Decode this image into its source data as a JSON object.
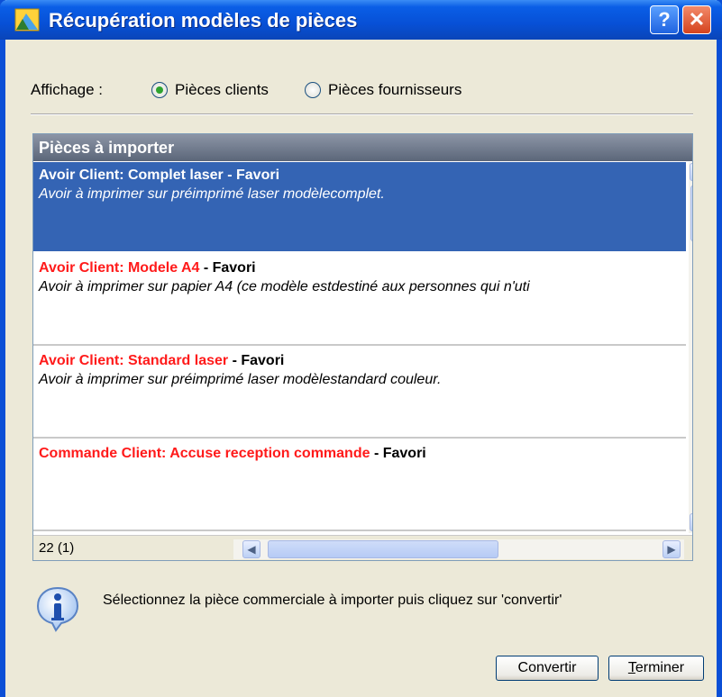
{
  "window": {
    "title": "Récupération modèles de pièces",
    "help_label": "?",
    "close_label": "✕",
    "colors": {
      "titlebar": "#0750d6",
      "selection": "#3464b4",
      "item_name": "#ff1a1a"
    }
  },
  "filter": {
    "label": "Affichage :",
    "options": [
      {
        "label": "Pièces clients",
        "selected": true
      },
      {
        "label": "Pièces fournisseurs",
        "selected": false
      }
    ]
  },
  "list": {
    "header": "Pièces à importer",
    "items": [
      {
        "name": "Avoir Client: Complet laser",
        "suffix": " - Favori",
        "description": "Avoir à imprimer sur préimprimé laser modèlecomplet.",
        "selected": true
      },
      {
        "name": "Avoir Client: Modele A4",
        "suffix": " - Favori",
        "description": "Avoir à imprimer sur papier A4 (ce modèle estdestiné aux personnes qui n'uti",
        "selected": false
      },
      {
        "name": "Avoir Client: Standard laser",
        "suffix": " - Favori",
        "description": "Avoir à imprimer sur préimprimé laser modèlestandard couleur.",
        "selected": false
      },
      {
        "name": "Commande Client: Accuse reception commande",
        "suffix": " - Favori",
        "description": "",
        "selected": false
      }
    ],
    "count": "22 (1)"
  },
  "info": {
    "icon": "info-icon",
    "text": "Sélectionnez la pièce commerciale à importer puis cliquez sur 'convertir'"
  },
  "buttons": {
    "convert": "Convertir",
    "finish": "Terminer"
  }
}
